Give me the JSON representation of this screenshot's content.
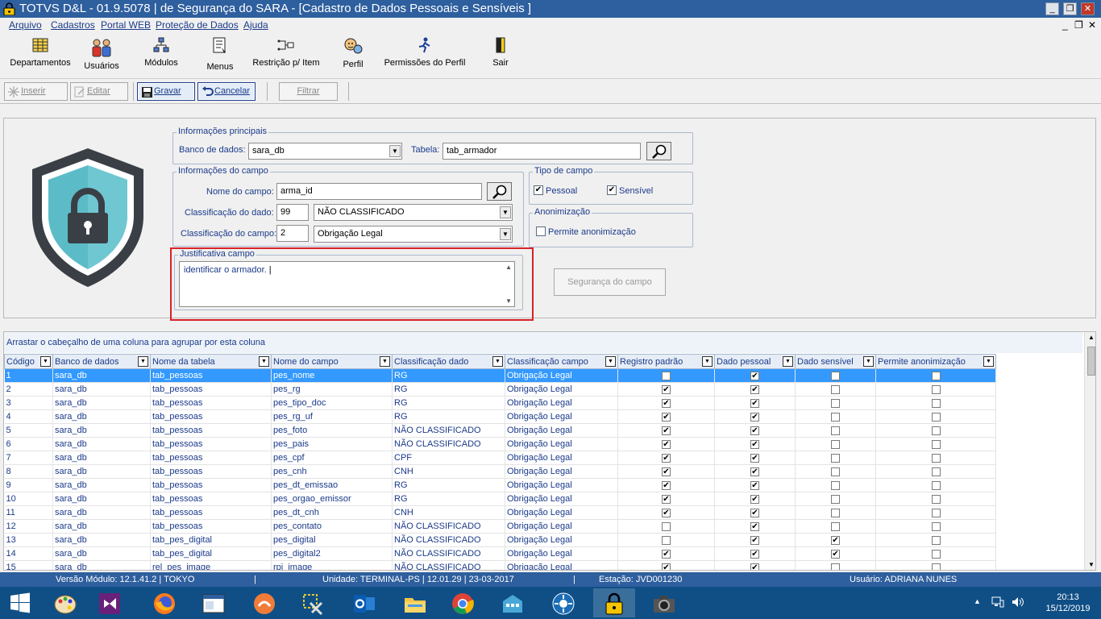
{
  "window": {
    "title": "TOTVS D&L - 01.9.5078 | de Segurança do SARA - [Cadastro de Dados Pessoais e Sensíveis ]",
    "minimize": "_",
    "maximize": "❐",
    "close": "✕",
    "mdi_minimize": "_",
    "mdi_restore": "❐",
    "mdi_close": "✕"
  },
  "menu": [
    "Arquivo",
    "Cadastros",
    "Portal WEB",
    "Proteção de Dados",
    "Ajuda"
  ],
  "modules": [
    "Departamentos",
    "Usuários",
    "Módulos",
    "Menus",
    "Restrição p/ Item",
    "Perfil",
    "Permissões do Perfil",
    "Sair"
  ],
  "actions": {
    "insert": "Inserir",
    "edit": "Editar",
    "save": "Gravar",
    "cancel": "Cancelar",
    "filter": "Filtrar"
  },
  "info_principal": {
    "legend": "Informações principais",
    "db_label": "Banco de dados:",
    "db_value": "sara_db",
    "table_label": "Tabela:",
    "table_value": "tab_armador"
  },
  "info_campo": {
    "legend": "Informações do campo",
    "name_label": "Nome do campo:",
    "name_value": "arma_id",
    "class_dado_label": "Classificação do dado:",
    "class_dado_code": "99",
    "class_dado_value": "NÃO CLASSIFICADO",
    "class_campo_label": "Classificação do campo:",
    "class_campo_code": "2",
    "class_campo_value": "Obrigação Legal"
  },
  "tipo_campo": {
    "legend": "Tipo de campo",
    "pessoal_label": "Pessoal",
    "pessoal_checked": true,
    "sensivel_label": "Sensível",
    "sensivel_checked": true
  },
  "anonimizacao": {
    "legend": "Anonimização",
    "label": "Permite anonimização",
    "checked": false
  },
  "justificativa": {
    "legend": "Justificativa campo",
    "text": "identificar o armador."
  },
  "seguranca_button": "Segurança do campo",
  "grid": {
    "group_hint": "Arrastar o cabeçalho de uma coluna para agrupar por esta coluna",
    "columns": [
      "Código",
      "Banco de dados",
      "Nome da tabela",
      "Nome do campo",
      "Classificação dado",
      "Classificação campo",
      "Registro padrão",
      "Dado pessoal",
      "Dado sensível",
      "Permite anonimização"
    ],
    "rows": [
      {
        "codigo": "1",
        "banco": "sara_db",
        "tabela": "tab_pessoas",
        "campo": "pes_nome",
        "class_dado": "RG",
        "class_campo": "Obrigação Legal",
        "padrao": false,
        "pessoal": true,
        "sensivel": false,
        "anonim": false
      },
      {
        "codigo": "2",
        "banco": "sara_db",
        "tabela": "tab_pessoas",
        "campo": "pes_rg",
        "class_dado": "RG",
        "class_campo": "Obrigação Legal",
        "padrao": true,
        "pessoal": true,
        "sensivel": false,
        "anonim": false
      },
      {
        "codigo": "3",
        "banco": "sara_db",
        "tabela": "tab_pessoas",
        "campo": "pes_tipo_doc",
        "class_dado": "RG",
        "class_campo": "Obrigação Legal",
        "padrao": true,
        "pessoal": true,
        "sensivel": false,
        "anonim": false
      },
      {
        "codigo": "4",
        "banco": "sara_db",
        "tabela": "tab_pessoas",
        "campo": "pes_rg_uf",
        "class_dado": "RG",
        "class_campo": "Obrigação Legal",
        "padrao": true,
        "pessoal": true,
        "sensivel": false,
        "anonim": false
      },
      {
        "codigo": "5",
        "banco": "sara_db",
        "tabela": "tab_pessoas",
        "campo": "pes_foto",
        "class_dado": "NÃO CLASSIFICADO",
        "class_campo": "Obrigação Legal",
        "padrao": true,
        "pessoal": true,
        "sensivel": false,
        "anonim": false
      },
      {
        "codigo": "6",
        "banco": "sara_db",
        "tabela": "tab_pessoas",
        "campo": "pes_pais",
        "class_dado": "NÃO CLASSIFICADO",
        "class_campo": "Obrigação Legal",
        "padrao": true,
        "pessoal": true,
        "sensivel": false,
        "anonim": false
      },
      {
        "codigo": "7",
        "banco": "sara_db",
        "tabela": "tab_pessoas",
        "campo": "pes_cpf",
        "class_dado": "CPF",
        "class_campo": "Obrigação Legal",
        "padrao": true,
        "pessoal": true,
        "sensivel": false,
        "anonim": false
      },
      {
        "codigo": "8",
        "banco": "sara_db",
        "tabela": "tab_pessoas",
        "campo": "pes_cnh",
        "class_dado": "CNH",
        "class_campo": "Obrigação Legal",
        "padrao": true,
        "pessoal": true,
        "sensivel": false,
        "anonim": false
      },
      {
        "codigo": "9",
        "banco": "sara_db",
        "tabela": "tab_pessoas",
        "campo": "pes_dt_emissao",
        "class_dado": "RG",
        "class_campo": "Obrigação Legal",
        "padrao": true,
        "pessoal": true,
        "sensivel": false,
        "anonim": false
      },
      {
        "codigo": "10",
        "banco": "sara_db",
        "tabela": "tab_pessoas",
        "campo": "pes_orgao_emissor",
        "class_dado": "RG",
        "class_campo": "Obrigação Legal",
        "padrao": true,
        "pessoal": true,
        "sensivel": false,
        "anonim": false
      },
      {
        "codigo": "11",
        "banco": "sara_db",
        "tabela": "tab_pessoas",
        "campo": "pes_dt_cnh",
        "class_dado": "CNH",
        "class_campo": "Obrigação Legal",
        "padrao": true,
        "pessoal": true,
        "sensivel": false,
        "anonim": false
      },
      {
        "codigo": "12",
        "banco": "sara_db",
        "tabela": "tab_pessoas",
        "campo": "pes_contato",
        "class_dado": "NÃO CLASSIFICADO",
        "class_campo": "Obrigação Legal",
        "padrao": false,
        "pessoal": true,
        "sensivel": false,
        "anonim": false
      },
      {
        "codigo": "13",
        "banco": "sara_db",
        "tabela": "tab_pes_digital",
        "campo": "pes_digital",
        "class_dado": "NÃO CLASSIFICADO",
        "class_campo": "Obrigação Legal",
        "padrao": false,
        "pessoal": true,
        "sensivel": true,
        "anonim": false
      },
      {
        "codigo": "14",
        "banco": "sara_db",
        "tabela": "tab_pes_digital",
        "campo": "pes_digital2",
        "class_dado": "NÃO CLASSIFICADO",
        "class_campo": "Obrigação Legal",
        "padrao": true,
        "pessoal": true,
        "sensivel": true,
        "anonim": false
      },
      {
        "codigo": "15",
        "banco": "sara_db",
        "tabela": "rel_pes_image",
        "campo": "rpi_image",
        "class_dado": "NÃO CLASSIFICADO",
        "class_campo": "Obrigação Legal",
        "padrao": true,
        "pessoal": true,
        "sensivel": false,
        "anonim": false
      }
    ],
    "selected_row": 0
  },
  "status": {
    "versao": "Versão Módulo:  12.1.41.2  |  TOKYO",
    "unidade": "Unidade: TERMINAL-PS | 12.01.29 | 23-03-2017",
    "estacao": "Estação: JVD001230",
    "usuario": "Usuário: ADRIANA NUNES"
  },
  "clock": {
    "time": "20:13",
    "date": "15/12/2019"
  },
  "colors": {
    "titlebar": "#2e5f9e",
    "label_blue": "#1a3a8a",
    "selected_row": "#3399ff",
    "highlight_red": "#d92128",
    "taskbar": "#0f4f86",
    "shield_teal": "#5bbcc8",
    "shield_dark": "#3a3f46"
  }
}
